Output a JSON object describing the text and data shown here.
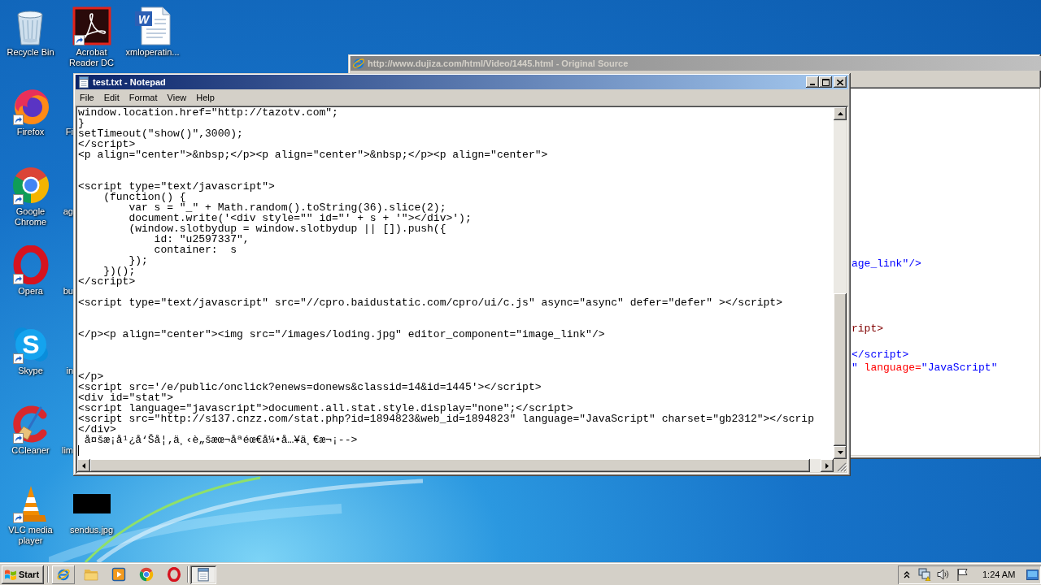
{
  "desktop": {
    "icons": [
      {
        "label": "Recycle Bin",
        "kind": "recycle_bin",
        "shortcut": false
      },
      {
        "label": "Firefox",
        "kind": "firefox",
        "shortcut": true
      },
      {
        "label": "Google Chrome",
        "kind": "chrome",
        "shortcut": true
      },
      {
        "label": "Opera",
        "kind": "opera",
        "shortcut": true
      },
      {
        "label": "Skype",
        "kind": "skype",
        "letter": "S",
        "shortcut": true
      },
      {
        "label": "CCleaner",
        "kind": "ccleaner",
        "shortcut": true
      },
      {
        "label": "VLC media player",
        "kind": "vlc",
        "shortcut": true
      },
      {
        "label": "Acrobat Reader DC",
        "kind": "acrobat",
        "shortcut": true
      },
      {
        "label": "Fi",
        "kind": "covered"
      },
      {
        "label": "ag",
        "kind": "covered"
      },
      {
        "label": "bu",
        "kind": "covered"
      },
      {
        "label": "in",
        "kind": "covered"
      },
      {
        "label": "lim",
        "kind": "covered"
      },
      {
        "label": "sendus.jpg",
        "kind": "image",
        "shortcut": false
      },
      {
        "label": "xmloperatin...",
        "kind": "word_doc",
        "letter": "W",
        "shortcut": false
      }
    ]
  },
  "source_window": {
    "title": "http://www.dujiza.com/html/Video/1445.html - Original Source",
    "active": false,
    "visible_lines": [
      [
        {
          "kind": "value",
          "text": "age_link\"/>"
        }
      ],
      [
        {
          "kind": "tag",
          "text": "ript>"
        }
      ],
      [
        {
          "kind": "value",
          "text": "</script>"
        }
      ],
      [
        {
          "kind": "value",
          "text": "\" "
        },
        {
          "kind": "attr",
          "text": "language="
        },
        {
          "kind": "value",
          "text": "\"JavaScript\""
        }
      ]
    ]
  },
  "notepad": {
    "title": "test.txt - Notepad",
    "active": true,
    "menu": [
      "File",
      "Edit",
      "Format",
      "View",
      "Help"
    ],
    "text": "window.location.href=\"http://tazotv.com\";\n}\nsetTimeout(\"show()\",3000);\n</script>\n<p align=\"center\">&nbsp;</p><p align=\"center\">&nbsp;</p><p align=\"center\">\n\n\n<script type=\"text/javascript\">\n    (function() {\n        var s = \"_\" + Math.random().toString(36).slice(2);\n        document.write('<div style=\"\" id=\"' + s + '\"></div>');\n        (window.slotbydup = window.slotbydup || []).push({\n            id: \"u2597337\",\n            container:  s\n        });\n    })();\n</script>\n\n<script type=\"text/javascript\" src=\"//cpro.baidustatic.com/cpro/ui/c.js\" async=\"async\" defer=\"defer\" ></script>\n\n\n</p><p align=\"center\"><img src=\"/images/loding.jpg\" editor_component=\"image_link\"/>\n\n\n\n</p>\n<script src='/e/public/onclick?enews=donews&classid=14&id=1445'></script>\n<div id=\"stat\">\n<script language=\"javascript\">document.all.stat.style.display=\"none\";</script>\n<script src=\"http://s137.cnzz.com/stat.php?id=1894823&web_id=1894823\" language=\"JavaScript\" charset=\"gb2312\"></scrip\n</div>\n å¤šæ¡å¹¿å‘Šå¦‚ä¸‹è„šæœ¬åªéœ€å¼•å…¥ä¸€æ¬¡-->"
  },
  "taskbar": {
    "start": "Start",
    "quick_launch": [
      {
        "kind": "ie",
        "raised": true
      },
      {
        "kind": "folder",
        "raised": false
      },
      {
        "kind": "media_player",
        "raised": false
      },
      {
        "kind": "chrome",
        "raised": false
      },
      {
        "kind": "opera",
        "raised": false
      }
    ],
    "tasks": [
      {
        "kind": "notepad",
        "selected": true
      }
    ],
    "tray_icons": [
      {
        "kind": "chevron"
      },
      {
        "kind": "network"
      },
      {
        "kind": "speaker"
      },
      {
        "kind": "flag"
      }
    ],
    "clock": "1:24 AM"
  }
}
